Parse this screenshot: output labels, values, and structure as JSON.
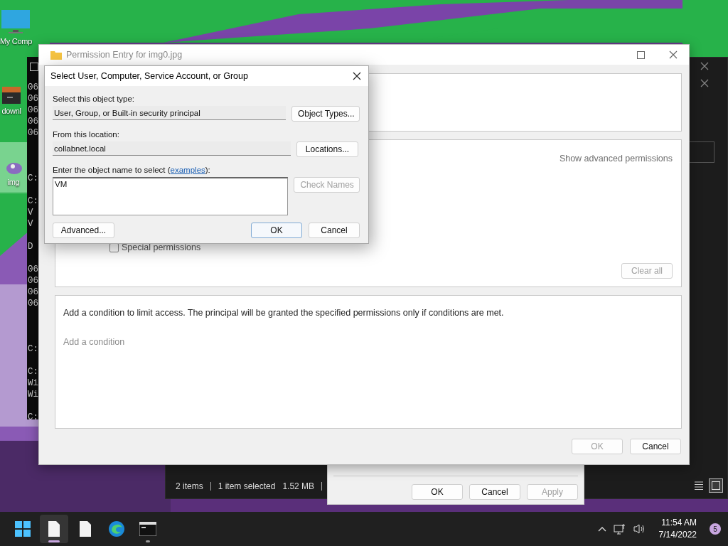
{
  "desktop": {
    "icons": [
      {
        "kind": "monitor",
        "label": "My Comp",
        "selected": false
      },
      {
        "kind": "archive",
        "label": "downl",
        "selected": false
      },
      {
        "label": "img",
        "selected": true
      }
    ]
  },
  "console": {
    "lines": [
      "06",
      "06",
      "06",
      "06",
      "06",
      "C:",
      "C:",
      "V",
      "V",
      "D",
      "06",
      "06",
      "06",
      "06",
      "C:",
      "C:",
      "Wi",
      "Wi",
      "C:"
    ]
  },
  "explorer": {
    "status": [
      "2 items",
      "1 item selected",
      "1.52 MB"
    ],
    "views": [
      {
        "kind": "details",
        "selected": false
      },
      {
        "kind": "tiles",
        "selected": true
      }
    ]
  },
  "properties_dialog": {
    "buttons": [
      {
        "label": "OK",
        "disabled": false
      },
      {
        "label": "Cancel",
        "disabled": false
      },
      {
        "label": "Apply",
        "disabled": true
      }
    ]
  },
  "permission_entry": {
    "title": "Permission Entry for img0.jpg",
    "active": false,
    "show_advanced": "Show advanced permissions",
    "special_permissions": {
      "label": "Special permissions",
      "checked": false
    },
    "clear_all": {
      "label": "Clear all",
      "disabled": true
    },
    "condition_text": "Add a condition to limit access. The principal will be granted the specified permissions only if conditions are met.",
    "add_condition": "Add a condition",
    "buttons": [
      {
        "label": "OK",
        "disabled": true
      },
      {
        "label": "Cancel",
        "disabled": false
      }
    ]
  },
  "select_dialog": {
    "title": "Select User, Computer, Service Account, or Group",
    "object_type": {
      "label": "Select this object type:",
      "value": "User, Group, or Built-in security principal",
      "button": "Object Types..."
    },
    "location": {
      "label": "From this location:",
      "value": "collabnet.local",
      "button": "Locations..."
    },
    "object_name": {
      "label": "Enter the object name to select (",
      "link": "examples",
      "label_end": "):",
      "value": "VM",
      "button": "Check Names",
      "button_disabled": true
    },
    "advanced": "Advanced...",
    "buttons": [
      {
        "label": "OK",
        "default": true
      },
      {
        "label": "Cancel",
        "default": false
      }
    ]
  },
  "taskbar": {
    "apps": [
      {
        "kind": "start",
        "active": false,
        "running": false
      },
      {
        "kind": "file",
        "active": true,
        "running": true
      },
      {
        "kind": "file",
        "active": false,
        "running": false
      },
      {
        "kind": "browser",
        "active": false,
        "running": false
      },
      {
        "kind": "terminal",
        "active": false,
        "running": true
      }
    ],
    "clock": {
      "time": "11:54 AM",
      "date": "7/14/2022"
    },
    "notifications": "5"
  }
}
